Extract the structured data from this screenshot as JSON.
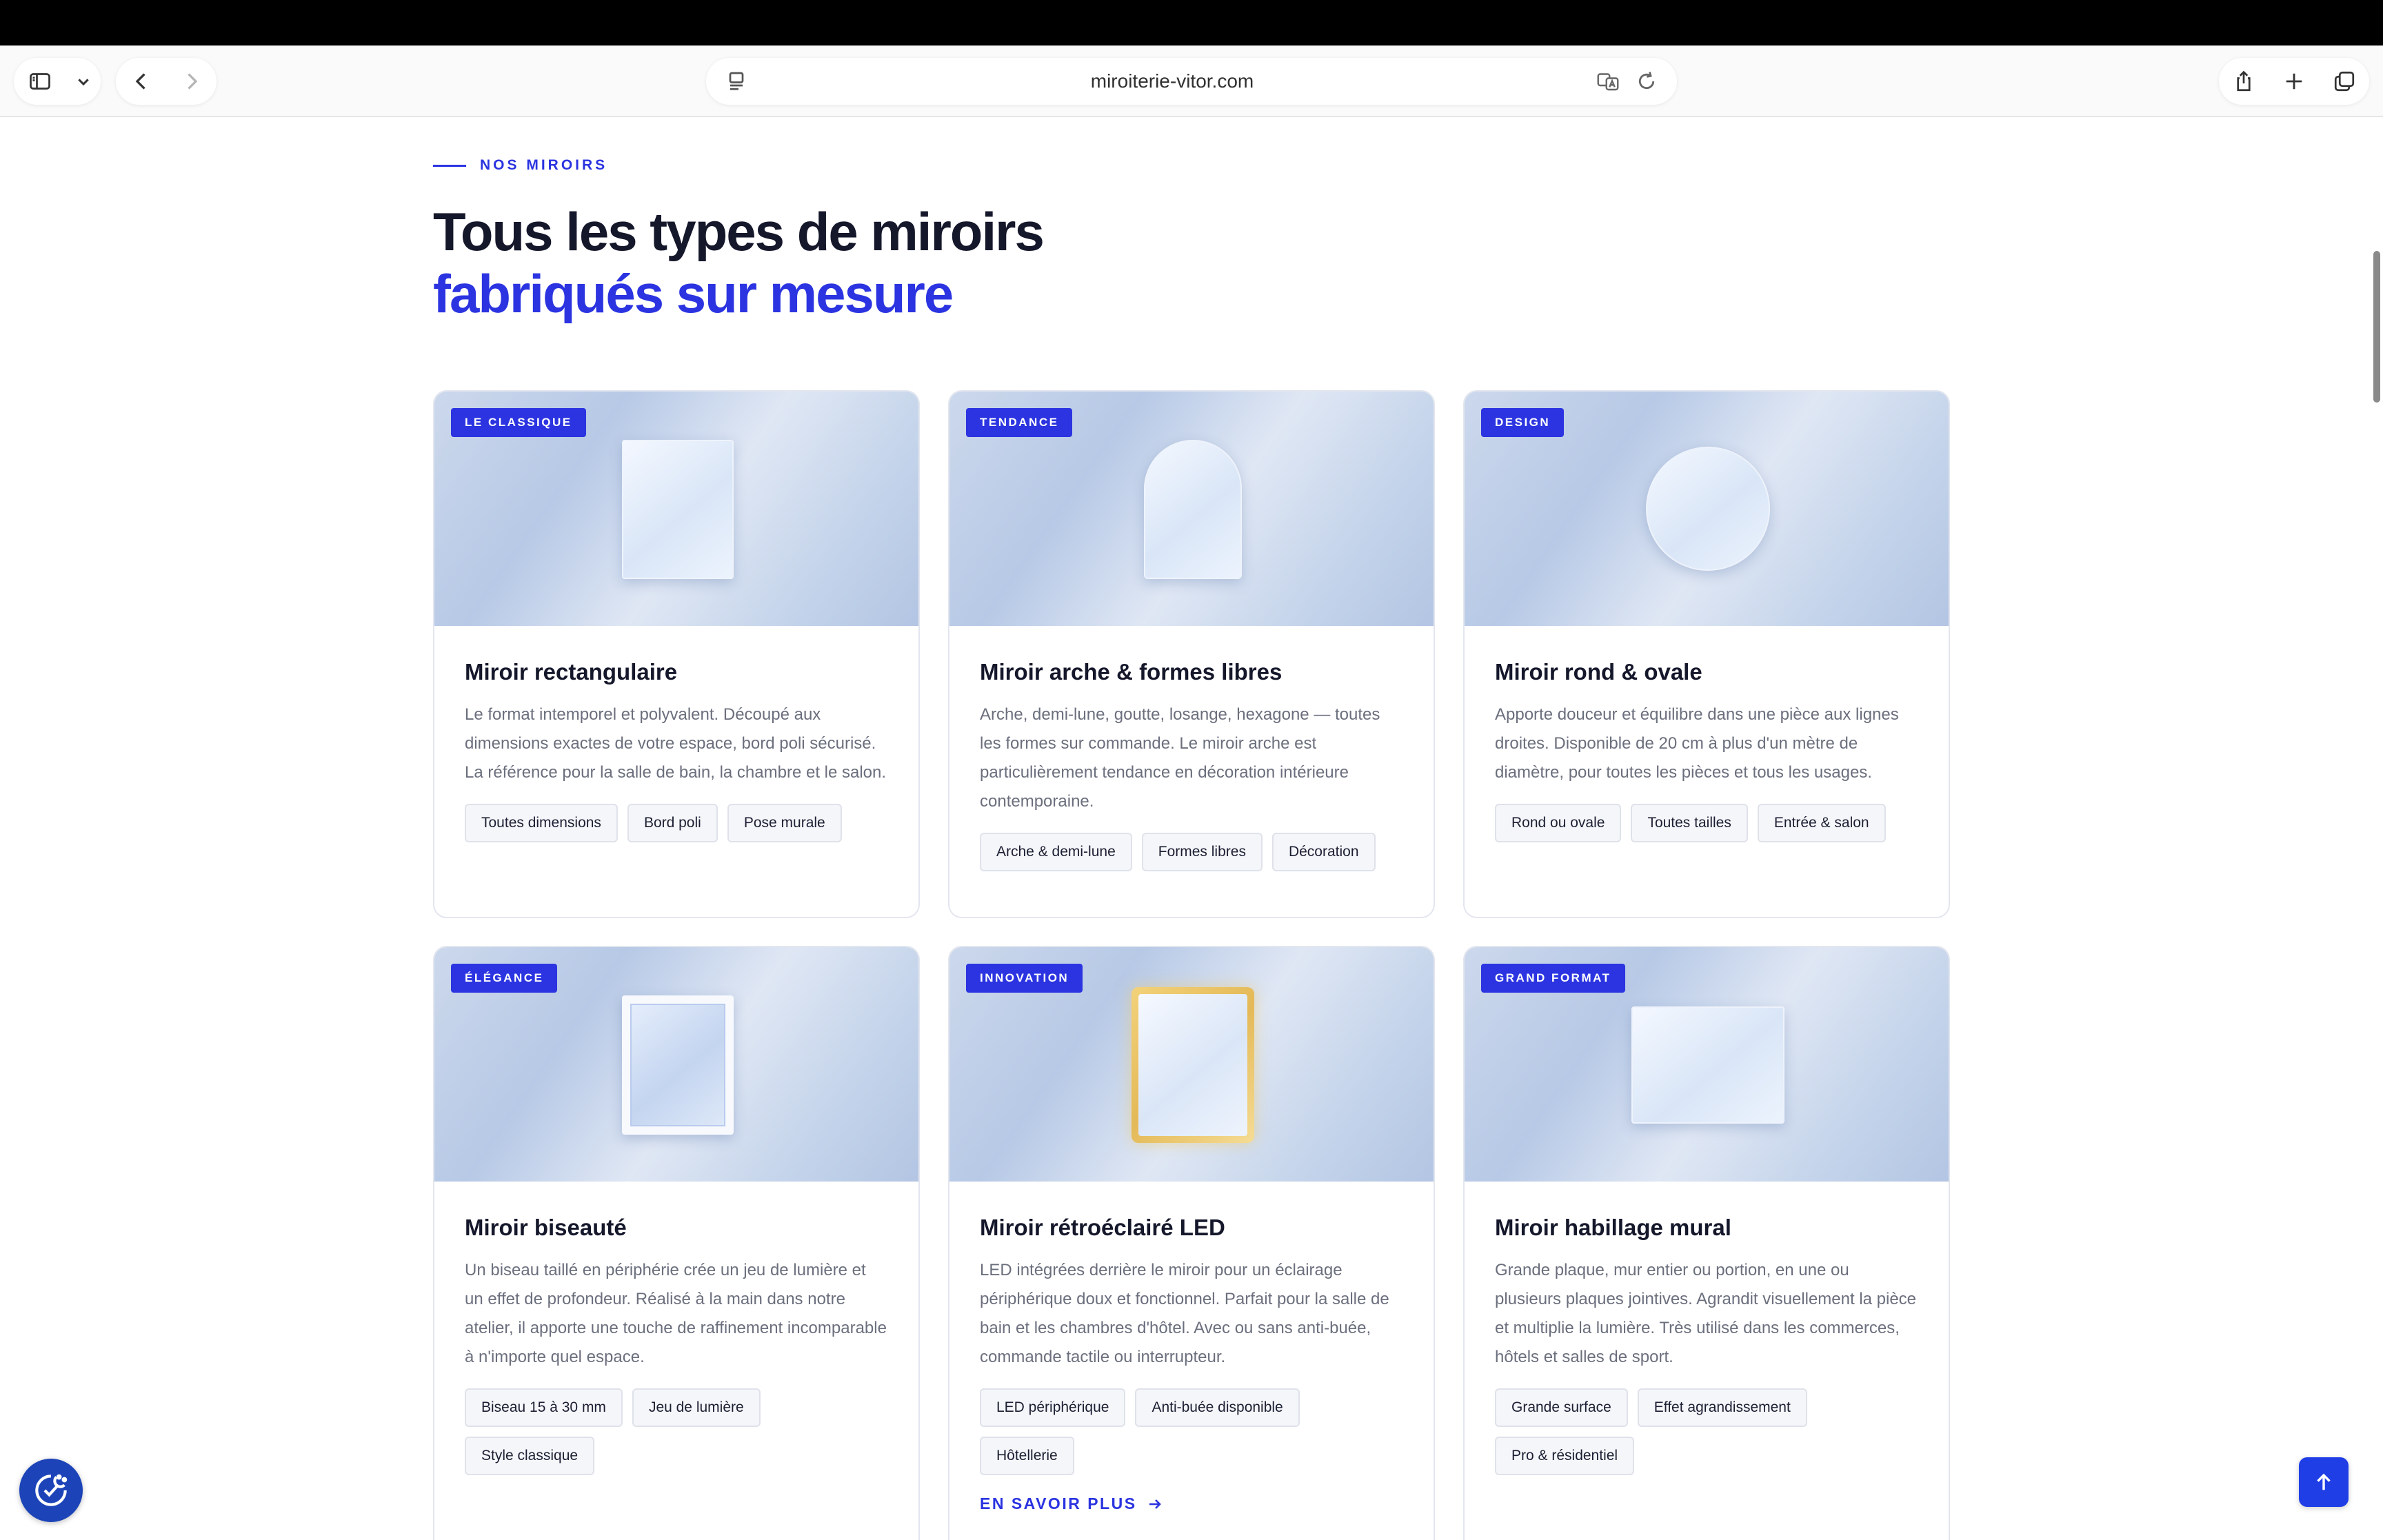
{
  "browser": {
    "url": "miroiterie-vitor.com"
  },
  "section": {
    "eyebrow": "NOS MIROIRS",
    "title_line1": "Tous les types de miroirs",
    "title_line2": "fabriqués sur mesure"
  },
  "cards": [
    {
      "badge": "LE CLASSIQUE",
      "title": "Miroir rectangulaire",
      "description": "Le format intemporel et polyvalent. Découpé aux dimensions exactes de votre espace, bord poli sécurisé. La référence pour la salle de bain, la chambre et le salon.",
      "tags": [
        "Toutes dimensions",
        "Bord poli",
        "Pose murale"
      ]
    },
    {
      "badge": "TENDANCE",
      "title": "Miroir arche & formes libres",
      "description": "Arche, demi-lune, goutte, losange, hexagone — toutes les formes sur commande. Le miroir arche est particulièrement tendance en décoration intérieure contemporaine.",
      "tags": [
        "Arche & demi-lune",
        "Formes libres",
        "Décoration"
      ]
    },
    {
      "badge": "DESIGN",
      "title": "Miroir rond & ovale",
      "description": "Apporte douceur et équilibre dans une pièce aux lignes droites. Disponible de 20 cm à plus d'un mètre de diamètre, pour toutes les pièces et tous les usages.",
      "tags": [
        "Rond ou ovale",
        "Toutes tailles",
        "Entrée & salon"
      ]
    },
    {
      "badge": "ÉLÉGANCE",
      "title": "Miroir biseauté",
      "description": "Un biseau taillé en périphérie crée un jeu de lumière et un effet de profondeur. Réalisé à la main dans notre atelier, il apporte une touche de raffinement incomparable à n'importe quel espace.",
      "tags": [
        "Biseau 15 à 30 mm",
        "Jeu de lumière",
        "Style classique"
      ]
    },
    {
      "badge": "INNOVATION",
      "title": "Miroir rétroéclairé LED",
      "description": "LED intégrées derrière le miroir pour un éclairage périphérique doux et fonctionnel. Parfait pour la salle de bain et les chambres d'hôtel. Avec ou sans anti-buée, commande tactile ou interrupteur.",
      "tags": [
        "LED périphérique",
        "Anti-buée disponible",
        "Hôtellerie"
      ],
      "more": "EN SAVOIR PLUS"
    },
    {
      "badge": "GRAND FORMAT",
      "title": "Miroir habillage mural",
      "description": "Grande plaque, mur entier ou portion, en une ou plusieurs plaques jointives. Agrandit visuellement la pièce et multiplie la lumière. Très utilisé dans les commerces, hôtels et salles de sport.",
      "tags": [
        "Grande surface",
        "Effet agrandissement",
        "Pro & résidentiel"
      ]
    }
  ],
  "icons": {
    "sidebar": "sidebar-icon",
    "chevron": "chevron-down-icon",
    "back": "back-arrow-icon",
    "forward": "forward-arrow-icon",
    "reader": "reader-icon",
    "translate": "translate-icon",
    "reload": "reload-icon",
    "share": "share-icon",
    "new_tab": "plus-icon",
    "tabs": "tabs-icon",
    "cookie": "cookie-consent-icon",
    "scroll_top": "arrow-up-icon"
  },
  "colors": {
    "accent": "#2b34e0",
    "heading": "#15172b",
    "body_text": "#6b6f7d"
  }
}
